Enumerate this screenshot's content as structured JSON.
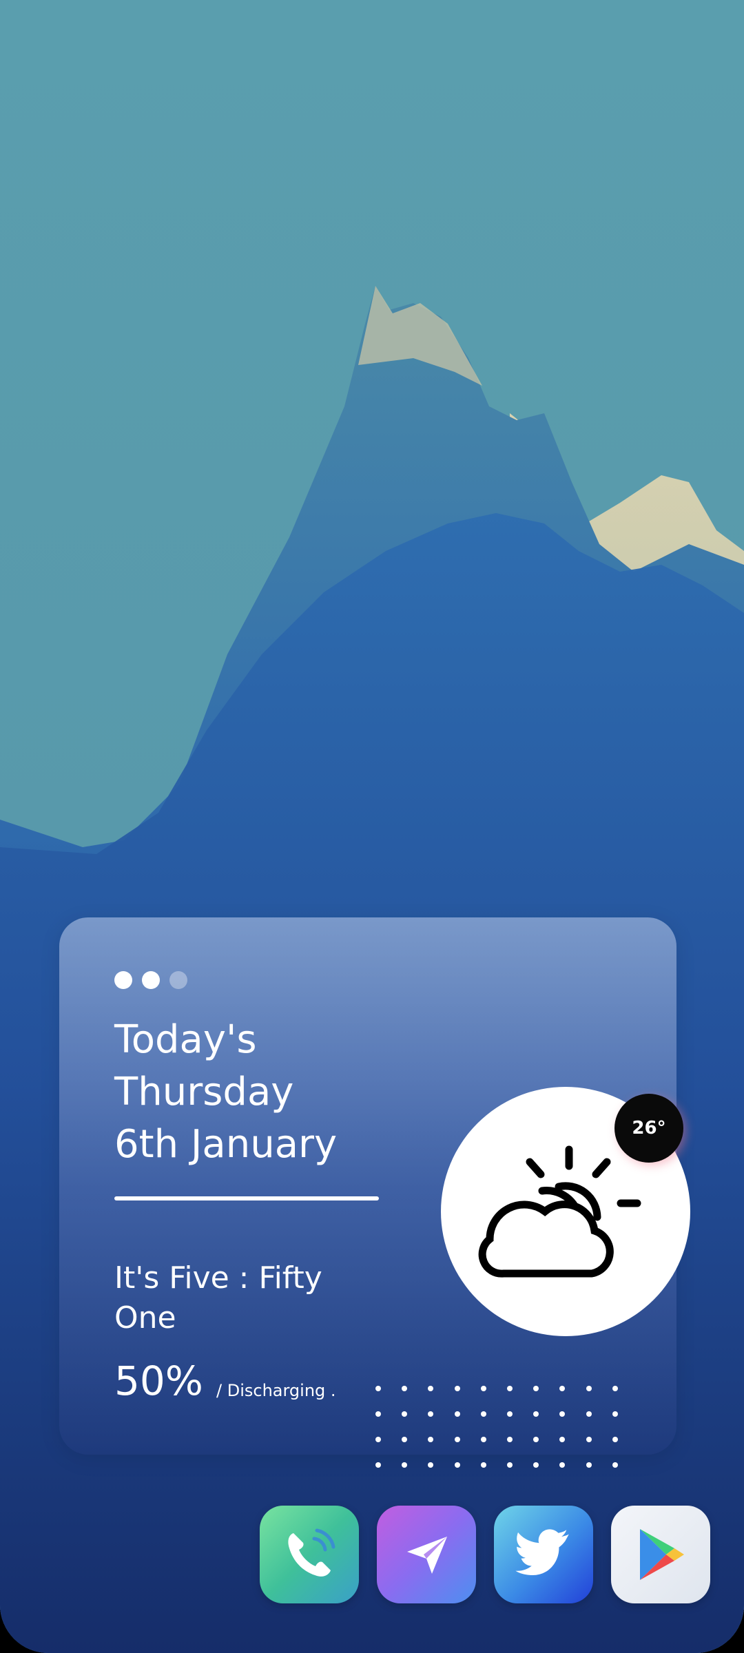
{
  "widget": {
    "page_indicator": {
      "count": 3,
      "active": 2
    },
    "date_line_1": "Today's",
    "date_line_2": "Thursday",
    "date_line_3": "6th January",
    "time_line_1": "It's Five : Fifty",
    "time_line_2": "One",
    "battery_percent": "50%",
    "battery_status": "/ Discharging ."
  },
  "weather": {
    "temperature": "26°",
    "icon": "partly-cloudy-icon"
  },
  "dock": {
    "apps": [
      {
        "name": "phone",
        "icon": "phone-icon"
      },
      {
        "name": "telegram",
        "icon": "paper-plane-icon"
      },
      {
        "name": "twitter",
        "icon": "bird-icon"
      },
      {
        "name": "play-store",
        "icon": "play-store-icon"
      }
    ]
  },
  "colors": {
    "sky": "#5a9eae",
    "mountain_deep": "#1d3f86",
    "widget_text": "#ffffff",
    "temp_badge": "#0a0a0a"
  }
}
